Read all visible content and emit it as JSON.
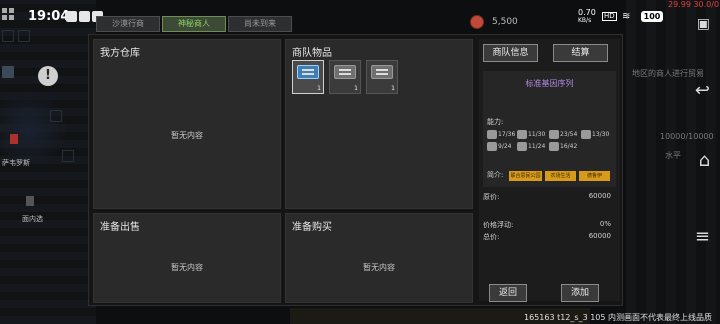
{
  "status": {
    "clock": "19:04",
    "speed": "0.70",
    "speed_unit": "KB/s",
    "hd": "HD",
    "battery": "100",
    "debug": "29.99 30.0/0"
  },
  "left": {
    "npc_label": "萨韦罗斯",
    "npc_label2": "面内选"
  },
  "tabs": [
    {
      "label": "沙漠行商"
    },
    {
      "label": "神秘商人"
    },
    {
      "label": "尚未到来"
    }
  ],
  "currency": {
    "value": "5,500"
  },
  "panels": {
    "warehouse": {
      "title": "我方仓库",
      "empty": "暂无内容"
    },
    "caravan": {
      "title": "商队物品",
      "slots": [
        {
          "qty": "1"
        },
        {
          "qty": "1"
        },
        {
          "qty": "1"
        }
      ]
    },
    "sell": {
      "title": "准备出售",
      "empty": "暂无内容"
    },
    "buy": {
      "title": "准备购买",
      "empty": "暂无内容"
    }
  },
  "detail": {
    "btn_info": "商队信息",
    "btn_settle": "结算",
    "item_name": "标准基因序列",
    "ability_label": "能力:",
    "abilities": [
      {
        "icon": "strength-icon",
        "text": "17/36"
      },
      {
        "icon": "book-icon",
        "text": "11/30"
      },
      {
        "icon": "agility-icon",
        "text": "23/54"
      },
      {
        "icon": "tools-icon",
        "text": "13/30"
      },
      {
        "icon": "leaf-icon",
        "text": "9/24"
      },
      {
        "icon": "hand-icon",
        "text": "11/24"
      },
      {
        "icon": "mind-icon",
        "text": "16/42"
      }
    ],
    "intro_label": "简介:",
    "tags": [
      "联合思民公园",
      "农场生活",
      "德鲁伊"
    ],
    "price_label": "原价:",
    "price_value": "60000",
    "float_label": "价格浮动:",
    "float_value": "0%",
    "total_label": "总价:",
    "total_value": "60000",
    "btn_back": "返回",
    "btn_add": "添加"
  },
  "right": {
    "hint": "地区的商人进行贸易",
    "counter": "10000/10000",
    "label_top": "水平"
  },
  "bottom": {
    "info": "165163 t12_s_3 105 内测画面不代表最终上线品质"
  },
  "colors": {
    "accent_green": "#8fd06a",
    "item_purple": "#b48ae8",
    "tag_orange": "#d89a1a"
  }
}
